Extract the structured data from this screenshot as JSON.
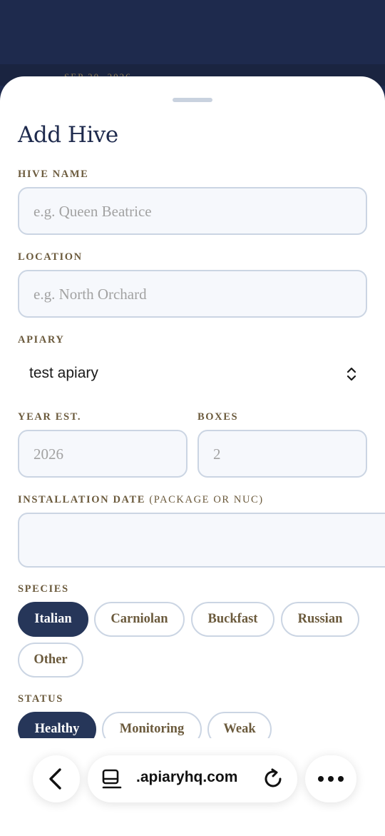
{
  "backdrop": {
    "date_text": "SEP 20, 2026"
  },
  "sheet": {
    "title": "Add Hive"
  },
  "hive_name": {
    "label": "HIVE NAME",
    "placeholder": "e.g. Queen Beatrice"
  },
  "location": {
    "label": "LOCATION",
    "placeholder": "e.g. North Orchard"
  },
  "apiary": {
    "label": "APIARY",
    "selected": "test apiary"
  },
  "year_est": {
    "label": "YEAR EST.",
    "placeholder": "2026"
  },
  "boxes": {
    "label": "BOXES",
    "placeholder": "2"
  },
  "installation": {
    "label": "INSTALLATION DATE",
    "label_sub": "(PACKAGE OR NUC)",
    "value": ""
  },
  "species": {
    "label": "SPECIES",
    "options": [
      "Italian",
      "Carniolan",
      "Buckfast",
      "Russian",
      "Other"
    ],
    "selected": "Italian"
  },
  "status": {
    "label": "STATUS",
    "options": [
      "Healthy",
      "Monitoring",
      "Weak"
    ],
    "selected": "Healthy"
  },
  "browser": {
    "url": ".apiaryhq.com",
    "icons": [
      "chevron-left-icon",
      "tabs-icon",
      "reload-icon",
      "more-icon"
    ]
  },
  "colors": {
    "navy": "#1e2a4d",
    "chip_active": "#263659",
    "label_brown": "#6b5a3c",
    "field_border": "#cbd5e3",
    "field_bg": "#f6f8fc"
  }
}
